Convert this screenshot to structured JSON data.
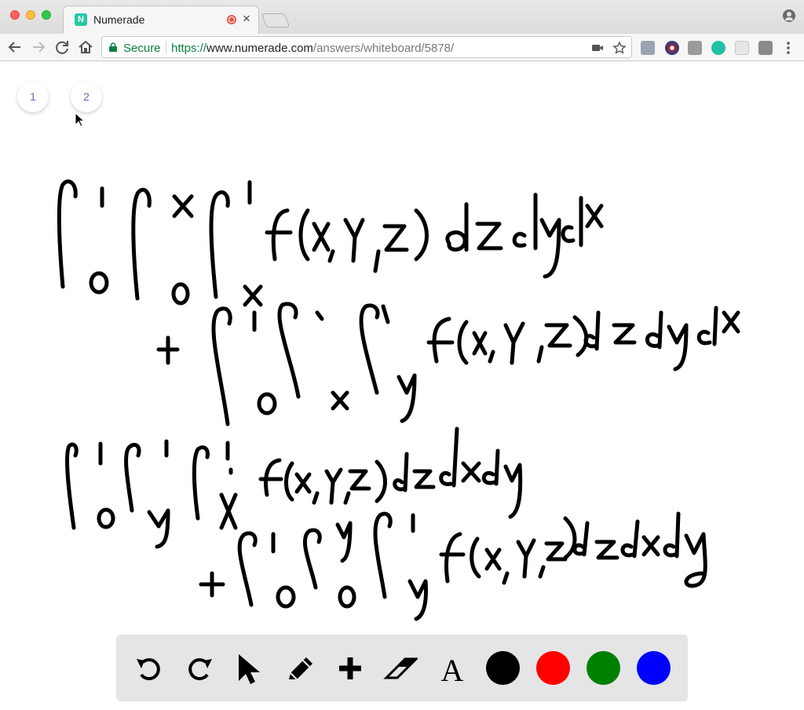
{
  "browser": {
    "tab_title": "Numerade",
    "tab_favicon_letter": "N",
    "close_glyph": "×",
    "secure_label": "Secure",
    "url_scheme": "https://",
    "url_host": "www.numerade.com",
    "url_path": "/answers/whiteboard/5878/"
  },
  "icons": {
    "back": "back-arrow-icon",
    "forward": "forward-arrow-icon",
    "reload": "reload-icon",
    "home": "home-icon",
    "lock": "lock-icon",
    "camera": "camera-icon",
    "bookmark": "star-icon",
    "profile": "profile-icon",
    "menu": "more-vertical-icon"
  },
  "extensions": [
    {
      "name": "extension-puzzle-icon",
      "color": "#9aa3b0"
    },
    {
      "name": "extension-flag-icon",
      "color": "#b22234"
    },
    {
      "name": "extension-k-icon",
      "color": "#9a9a9a"
    },
    {
      "name": "extension-m-icon",
      "color": "#22c1a5"
    },
    {
      "name": "extension-notes-icon",
      "color": "#c9c9c9"
    },
    {
      "name": "extension-box-icon",
      "color": "#8a8a8a"
    }
  ],
  "whiteboard": {
    "pages": [
      "1",
      "2"
    ],
    "ink_color": "#000000"
  },
  "tools": [
    {
      "name": "undo-icon"
    },
    {
      "name": "redo-icon"
    },
    {
      "name": "pointer-icon"
    },
    {
      "name": "pencil-icon"
    },
    {
      "name": "plus-icon"
    },
    {
      "name": "eraser-icon"
    },
    {
      "name": "text-icon",
      "glyph": "A"
    }
  ],
  "colors": [
    "#000000",
    "#ff0000",
    "#008000",
    "#0000ff"
  ]
}
